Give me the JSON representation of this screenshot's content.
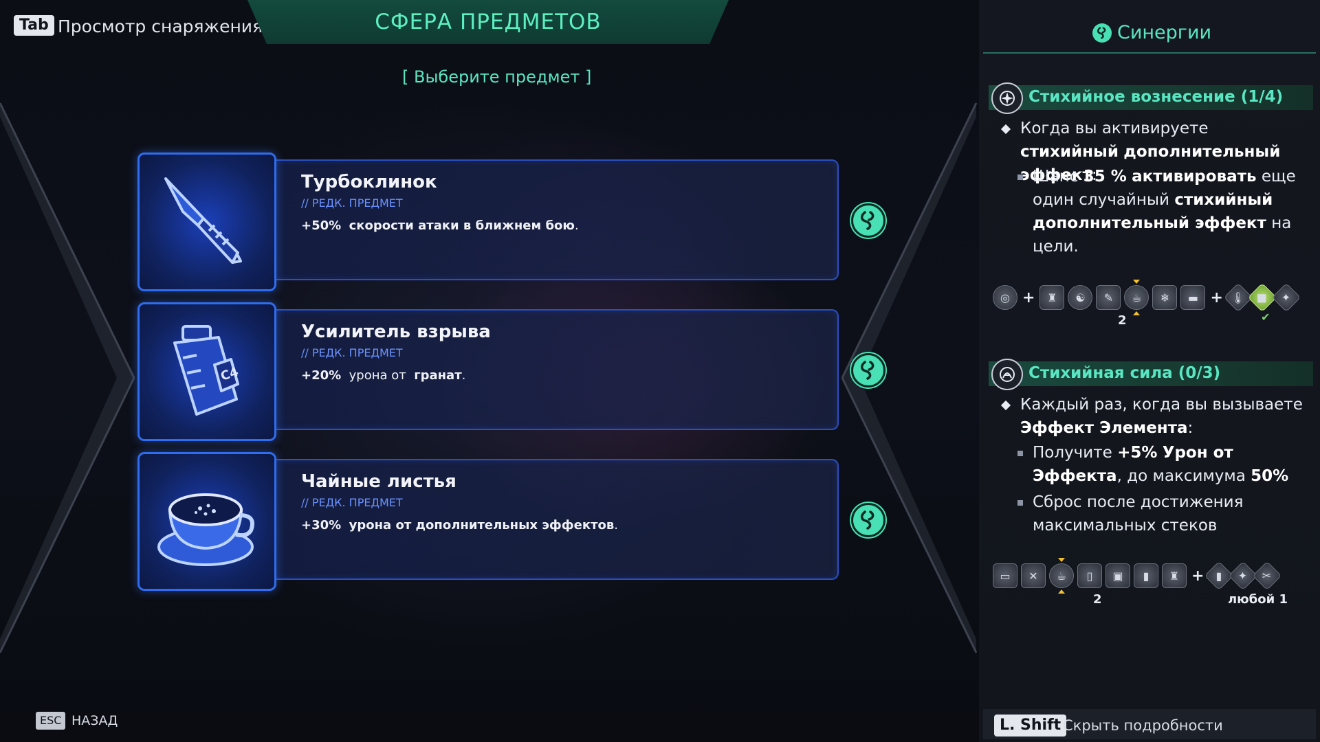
{
  "header": {
    "tab_key": "Tab",
    "tab_label": "Просмотр снаряжения",
    "title": "СФЕРА ПРЕДМЕТОВ",
    "subtitle": "[ Выберите предмет ]"
  },
  "items": [
    {
      "name": "Турбоклинок",
      "rarity": "// РЕДК. ПРЕДМЕТ",
      "desc_value": "+50%",
      "desc_text": "скорости атаки в ближнем бою",
      "desc_end": ".",
      "icon": "knife-icon"
    },
    {
      "name": "Усилитель взрыва",
      "rarity": "// РЕДК. ПРЕДМЕТ",
      "desc_value": "+20%",
      "desc_text": "урона от",
      "desc_bold": "гранат",
      "desc_end": ".",
      "icon": "c4-canister-icon"
    },
    {
      "name": "Чайные листья",
      "rarity": "// РЕДК. ПРЕДМЕТ",
      "desc_value": "+30%",
      "desc_text": "урона от дополнительных эффектов",
      "desc_end": ".",
      "icon": "tea-cup-icon"
    }
  ],
  "synergies": {
    "header": "Синергии",
    "list": [
      {
        "name": "Стихийное вознесение (1/4)",
        "trigger_a": "Когда вы активируете",
        "trigger_b": "стихийный",
        "trigger_c": "дополнительный эффект",
        "trigger_d": ":",
        "effect_a": "Шанс",
        "effect_b": "35 %",
        "effect_c": "активировать",
        "effect_d": "еще",
        "effect_e": "один случайный",
        "effect_f": "стихийный",
        "effect_g": "дополнительный эффект",
        "effect_h": "на",
        "effect_i": "цели.",
        "count": "2"
      },
      {
        "name": "Стихийная сила (0/3)",
        "trigger_a": "Каждый раз, когда вы вызываете",
        "trigger_b": "Эффект Элемента",
        "trigger_c": ":",
        "effect1_a": "Получите",
        "effect1_b": "+5%",
        "effect1_c": "Урон от",
        "effect1_d": "Эффекта",
        "effect1_e": ", до максимума",
        "effect1_f": "50%",
        "effect2_a": "Сброс после достижения",
        "effect2_b": "максимальных стеков",
        "count": "2",
        "any_label": "любой 1"
      }
    ]
  },
  "footer": {
    "shift_key": "L. Shift",
    "shift_label": "Скрыть подробности",
    "esc_key": "ESC",
    "esc_label": "НАЗАД"
  },
  "colors": {
    "accent": "#5ae6c2",
    "item_border": "#2f6df0",
    "rarity": "#6a92ff"
  }
}
